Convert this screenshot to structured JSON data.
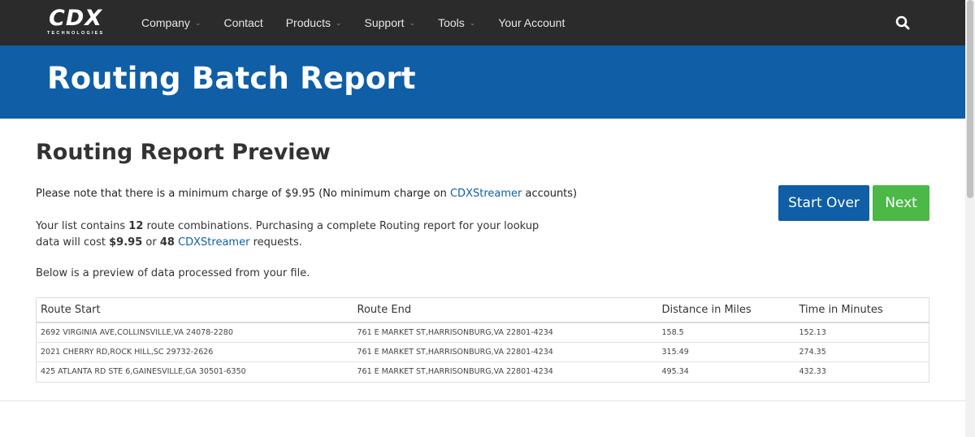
{
  "nav": {
    "logo": "CDX",
    "logo_sub": "TECHNOLOGIES",
    "items": [
      {
        "label": "Company",
        "dropdown": true
      },
      {
        "label": "Contact",
        "dropdown": false
      },
      {
        "label": "Products",
        "dropdown": true
      },
      {
        "label": "Support",
        "dropdown": true
      },
      {
        "label": "Tools",
        "dropdown": true
      },
      {
        "label": "Your Account",
        "dropdown": false
      }
    ],
    "search_icon": "search-icon"
  },
  "banner": {
    "title": "Routing Batch Report"
  },
  "content": {
    "title": "Routing Report Preview",
    "note_pre": "Please note that there is a minimum charge of $9.95 (No minimum charge on ",
    "note_link": "CDXStreamer",
    "note_post": " accounts)",
    "para_1": "Your list contains ",
    "para_count": "12",
    "para_2": " route combinations. Purchasing a complete Routing report for your lookup data will cost ",
    "para_cost": "$9.95",
    "para_3": " or ",
    "para_requests": "48",
    "para_4": " ",
    "para_link": "CDXStreamer",
    "para_5": " requests.",
    "preview_text": "Below is a preview of data processed from your file."
  },
  "buttons": {
    "start_over": "Start Over",
    "next": "Next"
  },
  "table": {
    "headers": [
      "Route Start",
      "Route End",
      "Distance in Miles",
      "Time in Minutes"
    ],
    "rows": [
      [
        "2692 VIRGINIA AVE,COLLINSVILLE,VA 24078-2280",
        "761 E MARKET ST,HARRISONBURG,VA 22801-4234",
        "158.5",
        "152.13"
      ],
      [
        "2021 CHERRY RD,ROCK HILL,SC 29732-2626",
        "761 E MARKET ST,HARRISONBURG,VA 22801-4234",
        "315.49",
        "274.35"
      ],
      [
        "425 ATLANTA RD STE 6,GAINESVILLE,GA 30501-6350",
        "761 E MARKET ST,HARRISONBURG,VA 22801-4234",
        "495.34",
        "432.33"
      ]
    ]
  },
  "colors": {
    "nav_bg": "#2b2b2b",
    "banner": "#0f5ea6",
    "primary": "#0f5ea6",
    "success": "#4cb848"
  }
}
